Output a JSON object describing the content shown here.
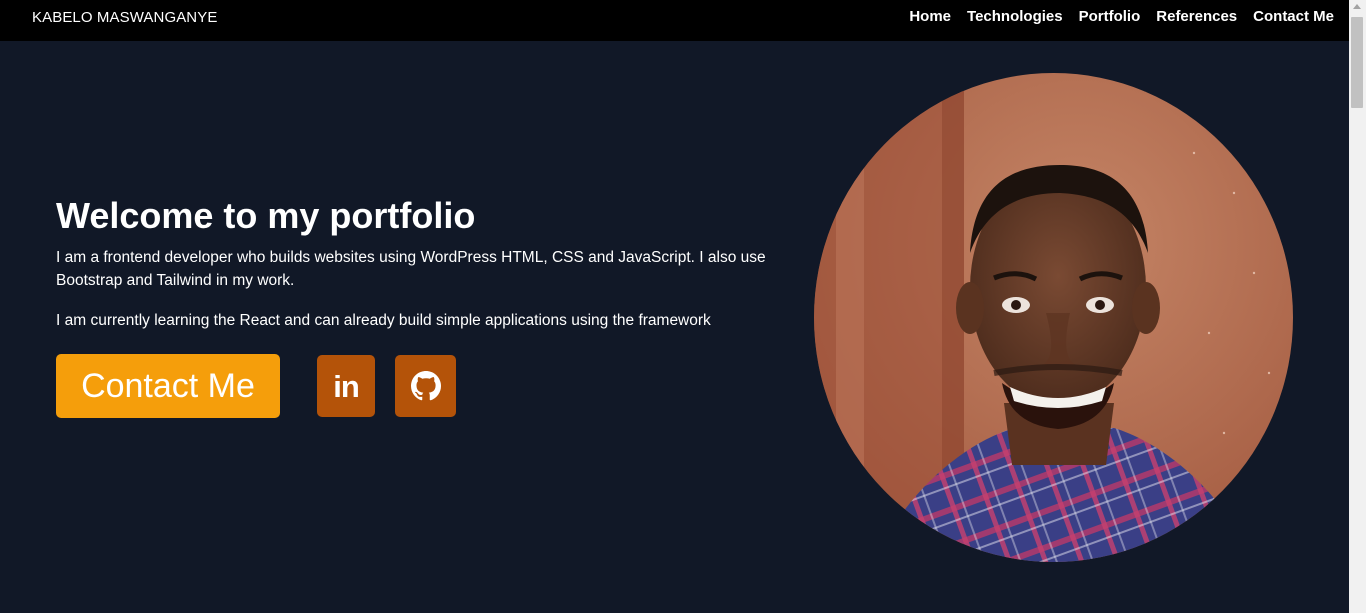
{
  "header": {
    "brand": "KABELO MASWANGANYE",
    "nav": [
      {
        "label": "Home"
      },
      {
        "label": "Technologies"
      },
      {
        "label": "Portfolio"
      },
      {
        "label": "References"
      },
      {
        "label": "Contact Me"
      }
    ]
  },
  "hero": {
    "title": "Welcome to my portfolio",
    "paragraphs": [
      "I am a frontend developer who builds websites using WordPress HTML, CSS and JavaScript. I also use Bootstrap and Tailwind in my work.",
      "I am currently learning the React and can already build simple applications using the framework"
    ],
    "contact_button": "Contact Me",
    "social": [
      {
        "icon": "linkedin-icon",
        "glyph": "in"
      },
      {
        "icon": "github-icon"
      }
    ]
  },
  "colors": {
    "page_background": "#111827",
    "navbar_background": "#000000",
    "contact_button": "#f59e0b",
    "social_button": "#b45309",
    "text": "#ffffff"
  }
}
